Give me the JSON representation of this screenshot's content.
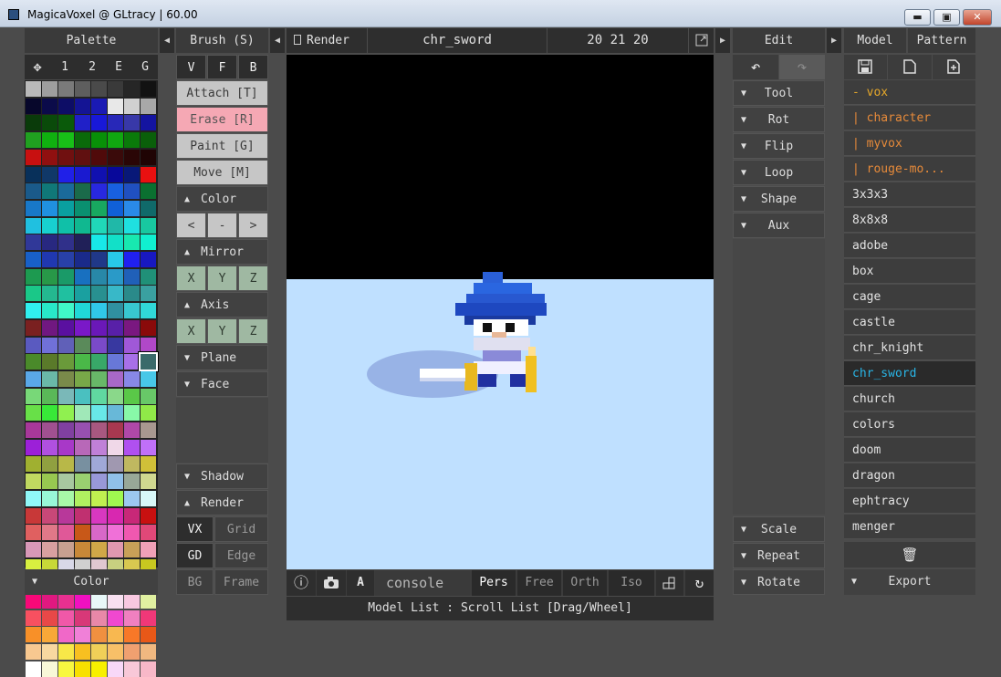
{
  "window": {
    "title": "MagicaVoxel @ GLtracy | 60.00",
    "minimize": "▬",
    "maximize": "▣",
    "close": "✕"
  },
  "palette": {
    "header": "Palette",
    "tabs": [
      "1",
      "2",
      "E",
      "G"
    ],
    "footer": "Color",
    "selected_index": 135,
    "colors": [
      "#b9b9b9",
      "#9e9e9e",
      "#7a7a7a",
      "#5e5e5e",
      "#4a4a4a",
      "#3a3a3a",
      "#262626",
      "#121212",
      "#07072b",
      "#0b0b4a",
      "#0d0d66",
      "#141494",
      "#1a1ab4",
      "#e8e8e8",
      "#d0d0d0",
      "#a8a8a8",
      "#0a3b0a",
      "#0a4a0a",
      "#0a5a0a",
      "#2020c8",
      "#1818d8",
      "#2828b8",
      "#3838a8",
      "#1414a0",
      "#20a020",
      "#10b010",
      "#18c018",
      "#0a6a0a",
      "#089008",
      "#10a810",
      "#0a7a0a",
      "#0a5f0a",
      "#c81010",
      "#901010",
      "#701010",
      "#601010",
      "#500a0a",
      "#3a0a0a",
      "#2a0606",
      "#1f0404",
      "#08305a",
      "#103868",
      "#2020e8",
      "#1a1ad0",
      "#1010b0",
      "#08089a",
      "#081878",
      "#e81010",
      "#1a5a8a",
      "#107878",
      "#1a6a9a",
      "#1a6a4a",
      "#2828e0",
      "#1860e0",
      "#2050c0",
      "#0a7030",
      "#1878c8",
      "#2090e0",
      "#0aa0a0",
      "#0a9070",
      "#18a860",
      "#1060d8",
      "#2a8ae8",
      "#106a6a",
      "#20c0e0",
      "#18d0d0",
      "#10c0a8",
      "#10b890",
      "#20d8b8",
      "#20b8a8",
      "#1fe0e0",
      "#18c8a0",
      "#303898",
      "#282880",
      "#30308a",
      "#202058",
      "#18e8e8",
      "#12e0c8",
      "#18e8b0",
      "#10f0d0",
      "#1860c8",
      "#2038b0",
      "#2840a8",
      "#1a2a8a",
      "#203888",
      "#28c8e8",
      "#2020f0",
      "#1818c0",
      "#1d9a50",
      "#289848",
      "#1a9a68",
      "#1870c0",
      "#2888a8",
      "#2a9ac8",
      "#2060b8",
      "#209078",
      "#1ac888",
      "#24b890",
      "#20c0a0",
      "#1aa0a0",
      "#289090",
      "#38b8c8",
      "#2a8a8a",
      "#3aa0a0",
      "#30f0f0",
      "#28e8c8",
      "#40f8c8",
      "#20d8d8",
      "#30c8e8",
      "#3090a0",
      "#38c8d0",
      "#30d8d8",
      "#7a2020",
      "#701880",
      "#5a10a0",
      "#7a18c8",
      "#6a18b8",
      "#5820a8",
      "#7a1880",
      "#8a0a0a",
      "#5a5ac0",
      "#7070d8",
      "#6060b8",
      "#5a8a5a",
      "#7a4ac8",
      "#3838a0",
      "#a058d8",
      "#b048c8",
      "#4a8a2a",
      "#5a7a2a",
      "#6a9a3a",
      "#4ab848",
      "#38a868",
      "#6878d8",
      "#a870e8",
      "#3a6a6a",
      "#5aa8e8",
      "#6ab8a8",
      "#7a8a4a",
      "#78a848",
      "#68b868",
      "#a868c8",
      "#8888e8",
      "#48c8e8",
      "#78d878",
      "#5ab858",
      "#7ab8b8",
      "#4ac0c0",
      "#60d8a0",
      "#8ad88a",
      "#5ac848",
      "#68c868",
      "#68e048",
      "#38e838",
      "#90f050",
      "#a0e8b8",
      "#68e8e8",
      "#68b8d8",
      "#88f8a8",
      "#90e848",
      "#a8389a",
      "#a05090",
      "#8040a0",
      "#9850b0",
      "#a85880",
      "#a83850",
      "#b048a8",
      "#a89890",
      "#9c20d8",
      "#b050e0",
      "#a838c8",
      "#b868b8",
      "#c080d8",
      "#f0d8e8",
      "#b050f0",
      "#c070f8",
      "#a0b030",
      "#90a040",
      "#b8b848",
      "#7890a0",
      "#a0a8d8",
      "#a098b0",
      "#c0b860",
      "#d0c038",
      "#c0d860",
      "#98c850",
      "#a8c8a0",
      "#9ad070",
      "#9898d8",
      "#90c0e8",
      "#98a898",
      "#d0d890",
      "#90f8f8",
      "#98f8d8",
      "#a8f8a8",
      "#b0f060",
      "#c0f050",
      "#a0f850",
      "#9cc8f0",
      "#d8f8f8",
      "#c83838",
      "#c84878",
      "#b8389a",
      "#c03070",
      "#d838c0",
      "#d828b0",
      "#c82878",
      "#c81010",
      "#e06060",
      "#e07888",
      "#e05898",
      "#c85818",
      "#d868c8",
      "#f070d8",
      "#f058b0",
      "#e04878",
      "#d898b8",
      "#d8a0a0",
      "#c8a090",
      "#c88838",
      "#d0a848",
      "#e098b0",
      "#c8a058",
      "#f0a0b8",
      "#d8f040",
      "#c8d838",
      "#d8d8e8",
      "#d0d0d0",
      "#e0c8d0",
      "#c8d080",
      "#d8c850",
      "#c8c820",
      "#d0f060",
      "#d8f838",
      "#e0e070",
      "#f0e098",
      "#e0f060",
      "#d8f878",
      "#e8e850",
      "#f0f040",
      "#f80878",
      "#e01880",
      "#e83090",
      "#f010c0",
      "#e8f8f8",
      "#f8e0f0",
      "#f8c8e0",
      "#e0f0a0",
      "#f85060",
      "#e84848",
      "#f058a8",
      "#d83878",
      "#e888a8",
      "#f048d0",
      "#f080c0",
      "#f03878",
      "#f89028",
      "#f8a838",
      "#f068c8",
      "#f080d8",
      "#f09040",
      "#f8b850",
      "#f87828",
      "#e85818",
      "#f8c890",
      "#f8d8a0",
      "#f8e848",
      "#f8c020",
      "#f0d058",
      "#f8c068",
      "#f0a070",
      "#f0b880",
      "#ffffff",
      "#f8f8d8",
      "#f8f840",
      "#f8e000",
      "#f8f000",
      "#f8d8f8",
      "#f8c8d8",
      "#f8b8c8"
    ]
  },
  "brush": {
    "header": "Brush (S)",
    "modes": [
      "V",
      "F",
      "B"
    ],
    "attach": "Attach [T]",
    "erase": "Erase  [R]",
    "paint": "Paint  [G]",
    "move": "Move   [M]",
    "color_label": "Color",
    "color_buttons": [
      "<",
      "-",
      ">"
    ],
    "mirror_label": "Mirror",
    "mirror_axes": [
      "X",
      "Y",
      "Z"
    ],
    "axis_label": "Axis",
    "axis_axes": [
      "X",
      "Y",
      "Z"
    ],
    "plane_label": "Plane",
    "face_label": "Face",
    "shadow_label": "Shadow",
    "render_label": "Render",
    "render_rows": [
      [
        "VX",
        "Grid"
      ],
      [
        "GD",
        "Edge"
      ],
      [
        "BG",
        "Frame"
      ]
    ]
  },
  "viewport": {
    "render_button": "Render",
    "model_name": "chr_sword",
    "dimensions": "20 21 20",
    "bottom": {
      "console": "console",
      "view_modes": [
        "Pers",
        "Free",
        "Orth",
        "Iso"
      ],
      "a_button": "A"
    },
    "status": "Model List : Scroll List [Drag/Wheel]",
    "colors": {
      "background": "#000000",
      "ground": "#bfe0ff"
    }
  },
  "edit": {
    "header": "Edit",
    "sections": [
      "Tool",
      "Rot",
      "Flip",
      "Loop",
      "Shape",
      "Aux"
    ],
    "bottom_sections": [
      "Scale",
      "Repeat",
      "Rotate"
    ]
  },
  "model_panel": {
    "tabs": [
      "Model",
      "Pattern"
    ],
    "folders": [
      "- vox",
      "| character",
      "| myvox",
      "| rouge-mo..."
    ],
    "items": [
      "3x3x3",
      "8x8x8",
      "adobe",
      "box",
      "cage",
      "castle",
      "chr_knight",
      "chr_sword",
      "church",
      "colors",
      "doom",
      "dragon",
      "ephtracy",
      "menger"
    ],
    "selected": "chr_sword",
    "export_label": "Export",
    "accent": "#29b5e6"
  }
}
